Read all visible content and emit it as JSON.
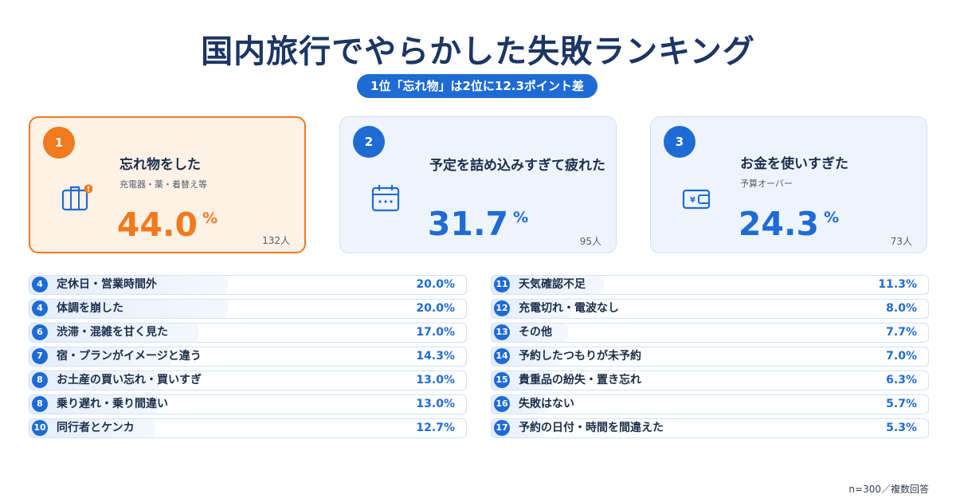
{
  "title": "国内旅行でやらかした失敗ランキング",
  "subtitle": "1位「忘れ物」は2位に12.3ポイント差",
  "percent_unit": "%",
  "count_unit": "人",
  "colors": {
    "accent": "#1f6bd4",
    "first": "#f07a1d",
    "title": "#1c3664"
  },
  "top3": [
    {
      "rank": "1",
      "name": "忘れ物をした",
      "sub": "充電器・薬・着替え等",
      "value": "44.0",
      "count": "132人",
      "icon": "suitcase-icon"
    },
    {
      "rank": "2",
      "name": "予定を詰め込みすぎて疲れた",
      "sub": "",
      "value": "31.7",
      "count": "95人",
      "icon": "calendar-icon"
    },
    {
      "rank": "3",
      "name": "お金を使いすぎた",
      "sub": "予算オーバー",
      "value": "24.3",
      "count": "73人",
      "icon": "wallet-icon"
    }
  ],
  "rest": [
    {
      "rank": "4",
      "label": "定休日・営業時間外",
      "value": "20.0%"
    },
    {
      "rank": "4",
      "label": "体調を崩した",
      "value": "20.0%"
    },
    {
      "rank": "6",
      "label": "渋滞・混雑を甘く見た",
      "value": "17.0%"
    },
    {
      "rank": "7",
      "label": "宿・プランがイメージと違う",
      "value": "14.3%"
    },
    {
      "rank": "8",
      "label": "お土産の買い忘れ・買いすぎ",
      "value": "13.0%"
    },
    {
      "rank": "8",
      "label": "乗り遅れ・乗り間違い",
      "value": "13.0%"
    },
    {
      "rank": "10",
      "label": "同行者とケンカ",
      "value": "12.7%"
    },
    {
      "rank": "11",
      "label": "天気確認不足",
      "value": "11.3%"
    },
    {
      "rank": "12",
      "label": "充電切れ・電波なし",
      "value": "8.0%"
    },
    {
      "rank": "13",
      "label": "その他",
      "value": "7.7%"
    },
    {
      "rank": "14",
      "label": "予約したつもりが未予約",
      "value": "7.0%"
    },
    {
      "rank": "15",
      "label": "貴重品の紛失・置き忘れ",
      "value": "6.3%"
    },
    {
      "rank": "16",
      "label": "失敗はない",
      "value": "5.7%"
    },
    {
      "rank": "17",
      "label": "予約の日付・時間を間違えた",
      "value": "5.3%"
    }
  ],
  "note": "n=300／複数回答",
  "chart_data": {
    "type": "bar",
    "title": "国内旅行でやらかした失敗ランキング",
    "categories": [
      "忘れ物をした",
      "予定を詰め込みすぎて疲れた",
      "お金を使いすぎた",
      "定休日・営業時間外",
      "体調を崩した",
      "渋滞・混雑を甘く見た",
      "宿・プランがイメージと違う",
      "お土産の買い忘れ・買いすぎ",
      "乗り遅れ・乗り間違い",
      "同行者とケンカ",
      "天気確認不足",
      "充電切れ・電波なし",
      "その他",
      "予約したつもりが未予約",
      "貴重品の紛失・置き忘れ",
      "失敗はない",
      "予約の日付・時間を間違えた"
    ],
    "values": [
      44.0,
      31.7,
      24.3,
      20.0,
      20.0,
      17.0,
      14.3,
      13.0,
      13.0,
      12.7,
      11.3,
      8.0,
      7.7,
      7.0,
      6.3,
      5.7,
      5.3
    ],
    "counts": [
      132,
      95,
      73
    ],
    "ylim": [
      0,
      44.0
    ]
  }
}
